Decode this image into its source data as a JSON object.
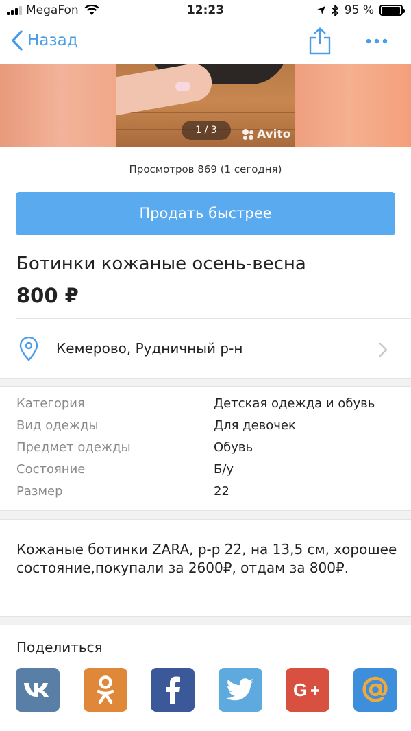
{
  "status_bar": {
    "carrier": "MegaFon",
    "time": "12:23",
    "battery_percent": "95 %",
    "battery_level": 0.95
  },
  "nav": {
    "back_label": "Назад"
  },
  "gallery": {
    "counter": "1 / 3",
    "watermark": "Avito"
  },
  "views_text": "Просмотров 869 (1 сегодня)",
  "sell_button_label": "Продать быстрее",
  "listing": {
    "title": "Ботинки кожаные осень-весна",
    "price": "800 ₽",
    "location": "Кемерово, Рудничный р-н"
  },
  "params": [
    {
      "key": "Категория",
      "value": "Детская одежда и обувь"
    },
    {
      "key": "Вид одежды",
      "value": "Для девочек"
    },
    {
      "key": "Предмет одежды",
      "value": "Обувь"
    },
    {
      "key": "Состояние",
      "value": "Б/у"
    },
    {
      "key": "Размер",
      "value": "22"
    }
  ],
  "description": "Кожаные ботинки ZARA, р-р 22, на 13,5 см, хорошее состояние,покупали за 2600₽, отдам за 800₽.",
  "share": {
    "title": "Поделиться",
    "networks": [
      {
        "name": "vk",
        "icon": "vk-icon",
        "color": "#5a7fa6"
      },
      {
        "name": "ok",
        "icon": "odnoklassniki-icon",
        "color": "#e0883a"
      },
      {
        "name": "facebook",
        "icon": "facebook-icon",
        "color": "#3b5998"
      },
      {
        "name": "twitter",
        "icon": "twitter-icon",
        "color": "#5ea9dd"
      },
      {
        "name": "google-plus",
        "icon": "google-plus-icon",
        "color": "#d85040"
      },
      {
        "name": "mail",
        "icon": "mail-at-icon",
        "color": "#3d8fdc"
      }
    ]
  },
  "colors": {
    "accent": "#4a9ee8",
    "button": "#5aaaf0"
  }
}
